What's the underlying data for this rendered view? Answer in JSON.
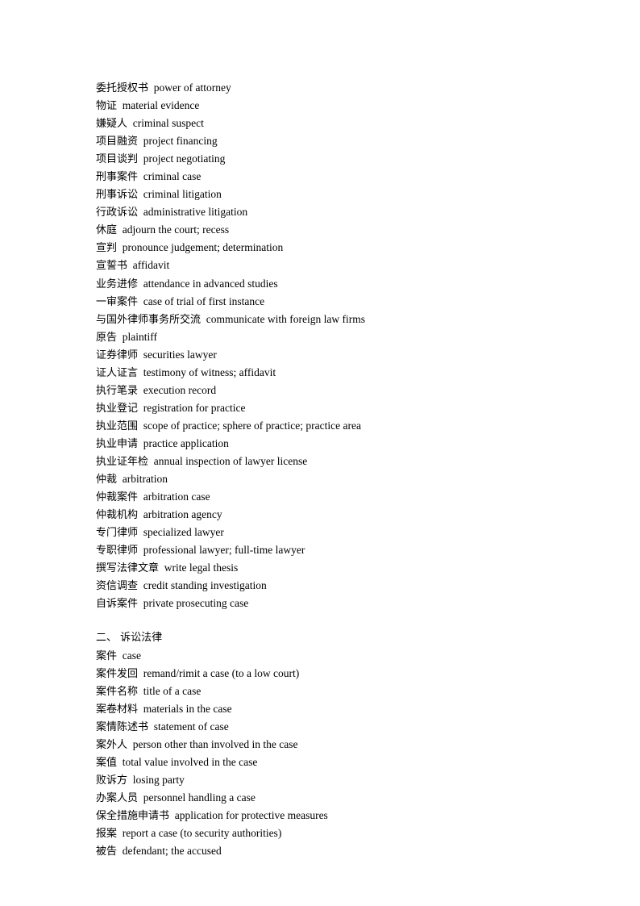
{
  "document": {
    "type": "glossary",
    "language_pair": "Chinese-English",
    "blocks": [
      {
        "kind": "entries",
        "entries": [
          {
            "term": "委托授权书",
            "definition": "power of attorney"
          },
          {
            "term": "物证",
            "definition": "material evidence"
          },
          {
            "term": "嫌疑人",
            "definition": "criminal suspect"
          },
          {
            "term": "项目融资",
            "definition": "project financing"
          },
          {
            "term": "项目谈判",
            "definition": "project negotiating"
          },
          {
            "term": "刑事案件",
            "definition": "criminal case"
          },
          {
            "term": "刑事诉讼",
            "definition": "criminal litigation"
          },
          {
            "term": "行政诉讼",
            "definition": "administrative litigation"
          },
          {
            "term": "休庭",
            "definition": "adjourn the court; recess"
          },
          {
            "term": "宣判",
            "definition": "pronounce judgement; determination"
          },
          {
            "term": "宣誓书",
            "definition": "affidavit"
          },
          {
            "term": "业务进修",
            "definition": "attendance in advanced studies"
          },
          {
            "term": "一审案件",
            "definition": "case of trial of first instance"
          },
          {
            "term": "与国外律师事务所交流",
            "definition": "communicate with foreign law firms"
          },
          {
            "term": "原告",
            "definition": "plaintiff"
          },
          {
            "term": "证券律师",
            "definition": "securities lawyer"
          },
          {
            "term": "证人证言",
            "definition": "testimony of witness; affidavit"
          },
          {
            "term": "执行笔录",
            "definition": "execution record"
          },
          {
            "term": "执业登记",
            "definition": "registration for practice"
          },
          {
            "term": "执业范围",
            "definition": "scope of practice; sphere of practice; practice area"
          },
          {
            "term": "执业申请",
            "definition": "practice application"
          },
          {
            "term": "执业证年检",
            "definition": "annual inspection of lawyer license"
          },
          {
            "term": "仲裁",
            "definition": "arbitration"
          },
          {
            "term": "仲裁案件",
            "definition": "arbitration case"
          },
          {
            "term": "仲裁机构",
            "definition": "arbitration agency"
          },
          {
            "term": "专门律师",
            "definition": "specialized lawyer"
          },
          {
            "term": "专职律师",
            "definition": "professional lawyer; full-time lawyer"
          },
          {
            "term": "撰写法律文章",
            "definition": "write legal thesis"
          },
          {
            "term": "资信调查",
            "definition": "credit standing investigation"
          },
          {
            "term": "自诉案件",
            "definition": "private prosecuting case"
          }
        ]
      },
      {
        "kind": "blank"
      },
      {
        "kind": "heading",
        "text": "二、 诉讼法律"
      },
      {
        "kind": "entries",
        "entries": [
          {
            "term": "案件",
            "definition": "case"
          },
          {
            "term": "案件发回",
            "definition": "remand/rimit a case (to a low court)"
          },
          {
            "term": "案件名称",
            "definition": "title of a case"
          },
          {
            "term": "案卷材料",
            "definition": "materials in the case"
          },
          {
            "term": "案情陈述书",
            "definition": "statement of case"
          },
          {
            "term": "案外人",
            "definition": "person other than involved in the case"
          },
          {
            "term": "案值",
            "definition": "total value involved in the case"
          },
          {
            "term": "败诉方",
            "definition": "losing party"
          },
          {
            "term": "办案人员",
            "definition": "personnel handling a case"
          },
          {
            "term": "保全措施申请书",
            "definition": "application for protective measures"
          },
          {
            "term": "报案",
            "definition": "report a case (to security authorities)"
          },
          {
            "term": "被告",
            "definition": "defendant; the accused"
          }
        ]
      }
    ]
  },
  "style": {
    "text_color": "#000000",
    "background_color": "#ffffff",
    "term_definition_separator": "  "
  }
}
